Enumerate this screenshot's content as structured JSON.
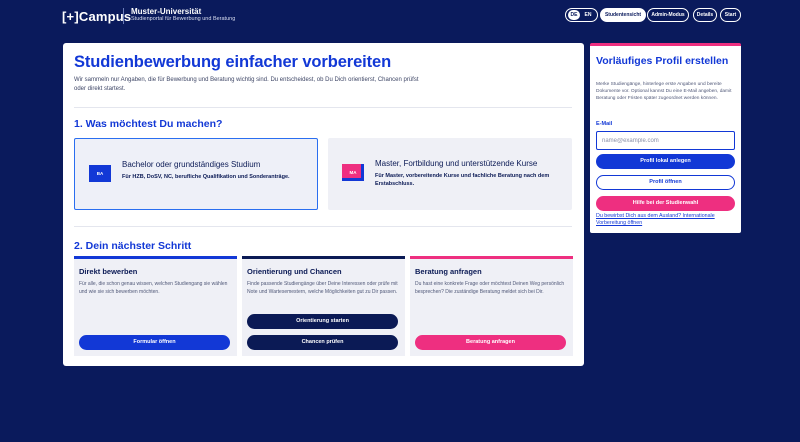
{
  "header": {
    "logo_bracket": "[+]",
    "logo_text": "Campus",
    "university": "Muster-Universität",
    "subtitle": "Studienportal für Bewerbung und Beratung",
    "languages": [
      "DE",
      "EN"
    ],
    "active_language": "DE",
    "nav": [
      "Studentensicht",
      "Admin-Modus",
      "Details",
      "Start"
    ],
    "active_nav": "Studentensicht"
  },
  "main": {
    "title": "Studienbewerbung einfacher vorbereiten",
    "intro": "Wir sammeln nur Angaben, die für Bewerbung und Beratung wichtig sind. Du entscheidest, ob Du Dich orientierst, Chancen prüfst oder direkt startest.",
    "section1_title": "1. Was möchtest Du machen?",
    "choices": [
      {
        "badge": "BA",
        "title": "Bachelor oder grundständiges Studium",
        "desc": "Für HZB, DoSV, NC, berufliche Qualifikation und Sonderanträge.",
        "selected": true
      },
      {
        "badge": "MA",
        "title": "Master, Fortbildung und unterstützende Kurse",
        "desc": "Für Master, vorbereitende Kurse und fachliche Beratung nach dem Erstabschluss.",
        "selected": false
      }
    ],
    "section2_title": "2. Dein nächster Schritt",
    "steps": [
      {
        "title": "Direkt bewerben",
        "desc": "Für alle, die schon genau wissen, welchen Studiengang sie wählen und wie sie sich bewerben möchten.",
        "buttons": [
          "Formular öffnen"
        ],
        "color": "#1238d6"
      },
      {
        "title": "Orientierung und Chancen",
        "desc": "Finde passende Studiengänge über Deine Interessen oder prüfe mit Note und Wartesemestern, welche Möglichkeiten gut zu Dir passen.",
        "buttons": [
          "Orientierung starten",
          "Chancen prüfen"
        ],
        "color": "#0b1a55"
      },
      {
        "title": "Beratung anfragen",
        "desc": "Du hast eine konkrete Frage oder möchtest Deinen Weg persönlich besprechen? Die zuständige Beratung meldet sich bei Dir.",
        "buttons": [
          "Beratung anfragen"
        ],
        "color": "#ee2f80"
      }
    ]
  },
  "side": {
    "title": "Vorläufiges Profil erstellen",
    "desc": "Merke Studiengänge, hinterlege erste Angaben und bereite Dokumente vor. Optional kannst Du eine E-Mail angeben, damit Beratung oder Fristen später zugeordnet werden können.",
    "email_label": "E-Mail",
    "email_placeholder": "name@example.com",
    "email_value": "",
    "btn_create": "Profil lokal anlegen",
    "btn_open": "Profil öffnen",
    "btn_help": "Hilfe bei der Studienwahl",
    "link": "Du bewirbst Dich aus dem Ausland? Internationale Vorbereitung öffnen"
  }
}
